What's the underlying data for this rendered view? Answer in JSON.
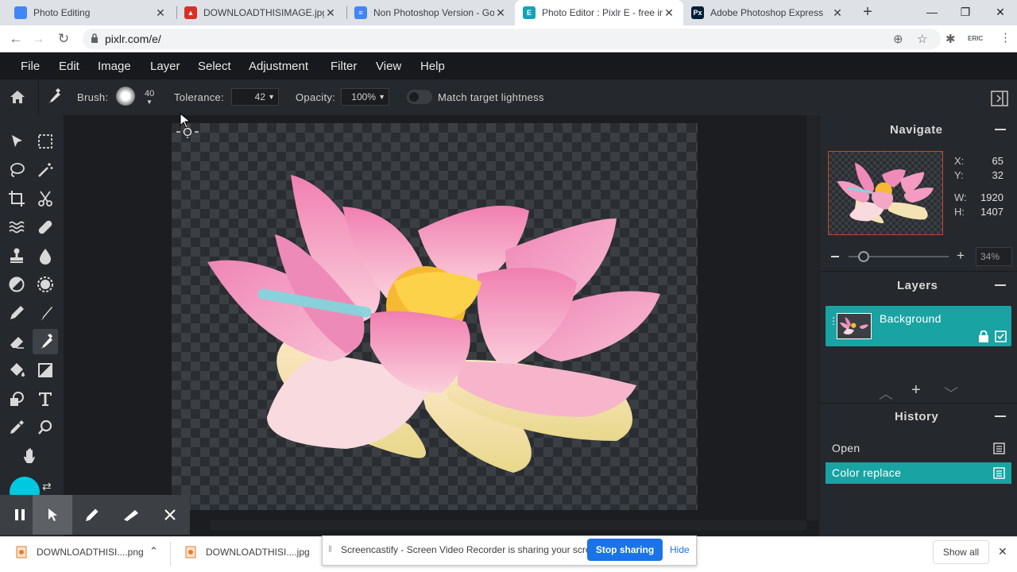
{
  "browser": {
    "tabs": [
      {
        "title": "Photo Editing",
        "icon": "google-sites-icon",
        "color": "#4285f4"
      },
      {
        "title": "DOWNLOADTHISIMAGE.jpg - (",
        "icon": "image-file-icon",
        "color": "#d93025"
      },
      {
        "title": "Non Photoshop Version - Goo",
        "icon": "google-docs-icon",
        "color": "#4285f4"
      },
      {
        "title": "Photo Editor : Pixlr E - free ima",
        "icon": "pixlr-e-icon",
        "color": "#17a2b8"
      },
      {
        "title": "Adobe Photoshop Express",
        "icon": "photoshop-express-icon",
        "color": "#001e36"
      }
    ],
    "url": "pixlr.com/e/",
    "profile": "ERIC"
  },
  "menu": [
    "File",
    "Edit",
    "Image",
    "Layer",
    "Select",
    "Adjustment",
    "Filter",
    "View",
    "Help"
  ],
  "options": {
    "brush_label": "Brush:",
    "brush_size": "40",
    "tolerance_label": "Tolerance:",
    "tolerance_value": "42",
    "opacity_label": "Opacity:",
    "opacity_value": "100%",
    "match_label": "Match target lightness",
    "match_enabled": false
  },
  "panels": {
    "navigate": {
      "title": "Navigate",
      "x_label": "X:",
      "x": "65",
      "y_label": "Y:",
      "y": "32",
      "w_label": "W:",
      "w": "1920",
      "h_label": "H:",
      "h": "1407",
      "zoom": "34%"
    },
    "layers": {
      "title": "Layers",
      "items": [
        {
          "name": "Background",
          "locked": true,
          "visible": true
        }
      ]
    },
    "history": {
      "title": "History",
      "items": [
        {
          "name": "Open",
          "active": false
        },
        {
          "name": "Color replace",
          "active": true
        }
      ]
    }
  },
  "colors": {
    "accent": "#1aa3a3",
    "foreground_color": "#00c8e0"
  },
  "downloads": {
    "items": [
      "DOWNLOADTHISI....png",
      "DOWNLOADTHISI....jpg"
    ],
    "notice": "Screencastify - Screen Video Recorder is sharing your screen.",
    "stop_label": "Stop sharing",
    "hide_label": "Hide",
    "show_all": "Show all"
  }
}
